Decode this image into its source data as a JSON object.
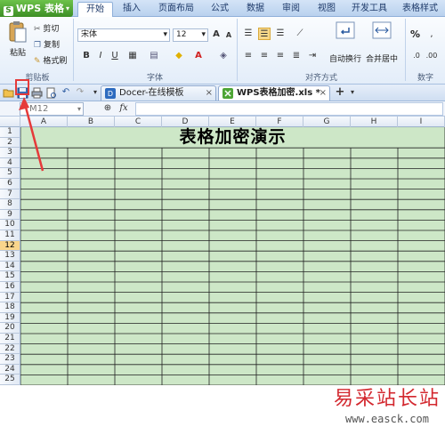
{
  "app": {
    "name": "WPS 表格",
    "logo_letter": "S"
  },
  "menu_tabs": [
    "开始",
    "插入",
    "页面布局",
    "公式",
    "数据",
    "审阅",
    "视图",
    "开发工具",
    "表格样式"
  ],
  "active_menu_tab": "开始",
  "clipboard": {
    "paste": "粘贴",
    "cut": "剪切",
    "copy": "复制",
    "format_painter": "格式刷",
    "group_label": "剪贴板"
  },
  "font": {
    "name": "宋体",
    "size": "12",
    "group_label": "字体"
  },
  "alignment": {
    "wrap": "自动换行",
    "merge": "合并居中",
    "group_label": "对齐方式"
  },
  "number": {
    "percent": "%",
    "group_label": "数字"
  },
  "doc_tabs": [
    {
      "label": "Docer-在线模板",
      "active": false
    },
    {
      "label": "WPS表格加密.xls *",
      "active": true
    }
  ],
  "name_box": "M12",
  "formula_fx": "fx",
  "columns": [
    "A",
    "B",
    "C",
    "D",
    "E",
    "F",
    "G",
    "H",
    "I"
  ],
  "rows": [
    "1",
    "2",
    "3",
    "4",
    "5",
    "6",
    "7",
    "8",
    "9",
    "10",
    "11",
    "12",
    "13",
    "14",
    "15",
    "16",
    "17",
    "18",
    "19",
    "20",
    "21",
    "22",
    "23",
    "24",
    "25"
  ],
  "selected_row": "12",
  "sheet_title": "表格加密演示",
  "watermark": {
    "cn": "易采站长站",
    "url": "www.easck.com"
  },
  "colors": {
    "cell_fill": "#cde7c7",
    "callout": "#e53a3a",
    "app_green": "#4ea535"
  }
}
